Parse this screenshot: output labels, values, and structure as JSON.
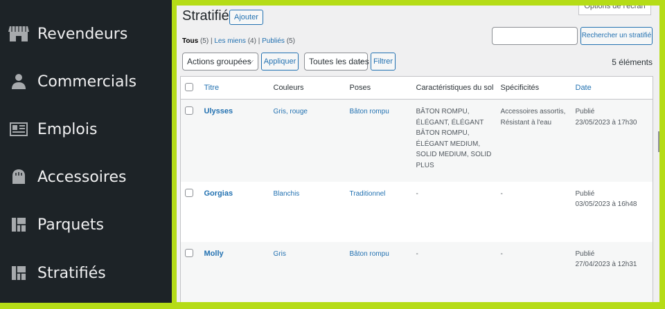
{
  "sidebar": {
    "items": [
      {
        "label": "Revendeurs",
        "icon": "store-icon"
      },
      {
        "label": "Commercials",
        "icon": "person-icon"
      },
      {
        "label": "Emplois",
        "icon": "id-card-icon"
      },
      {
        "label": "Accessoires",
        "icon": "bag-icon"
      },
      {
        "label": "Parquets",
        "icon": "layout-icon"
      },
      {
        "label": "Stratifiés",
        "icon": "layout-icon"
      }
    ]
  },
  "header": {
    "title": "Stratifiés",
    "add_label": "Ajouter",
    "screen_options": "Options de l'écran"
  },
  "filters": {
    "all": {
      "label": "Tous",
      "count": "(5)"
    },
    "mine": {
      "label": "Les miens",
      "count": "(4)"
    },
    "published": {
      "label": "Publiés",
      "count": "(5)"
    },
    "sep": "|"
  },
  "search": {
    "value": "",
    "button": "Rechercher un stratifié"
  },
  "bulk": {
    "select": "Actions groupées",
    "apply": "Appliquer",
    "dates": "Toutes les dates",
    "filter": "Filtrer",
    "count": "5 éléments"
  },
  "table": {
    "columns": [
      "Titre",
      "Couleurs",
      "Poses",
      "Caractéristiques du sol",
      "Spécificités",
      "Date"
    ],
    "rows": [
      {
        "title": "Ulysses",
        "colors": "Gris, rouge",
        "poses": "Bâton rompu",
        "features": "BÂTON ROMPU, ÉLÉGANT, ÉLÉGANT BÂTON ROMPU, ÉLÉGANT MEDIUM, SOLID MEDIUM, SOLID PLUS",
        "specs": "Accessoires assortis, Résistant à l'eau",
        "status": "Publié",
        "date": "23/05/2023 à 17h30"
      },
      {
        "title": "Gorgias",
        "colors": "Blanchis",
        "poses": "Traditionnel",
        "features": "-",
        "specs": "-",
        "status": "Publié",
        "date": "03/05/2023 à 16h48"
      },
      {
        "title": "Molly",
        "colors": "Gris",
        "poses": "Bâton rompu",
        "features": "-",
        "specs": "-",
        "status": "Publié",
        "date": "27/04/2023 à 12h31"
      }
    ]
  },
  "colors": {
    "frame": "#b5dc17",
    "sidebar_bg": "#1d2327",
    "link": "#2271b1"
  }
}
